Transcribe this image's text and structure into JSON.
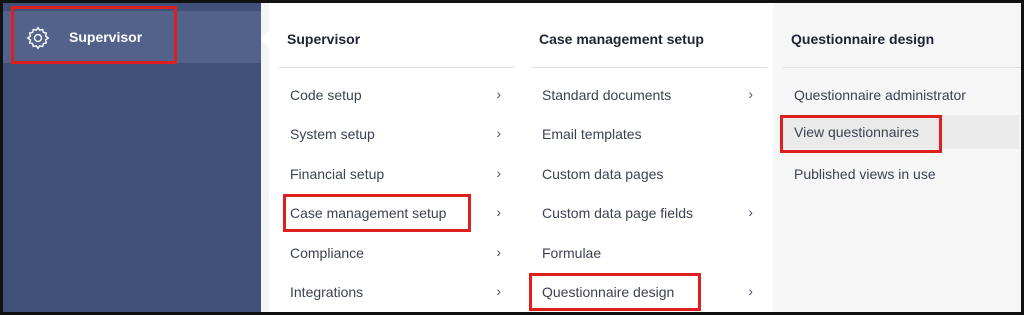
{
  "sidebar": {
    "item_label": "Supervisor",
    "item_icon": "gear-icon"
  },
  "columns": [
    {
      "title": "Supervisor",
      "items": [
        {
          "label": "Code setup",
          "has_submenu": true
        },
        {
          "label": "System setup",
          "has_submenu": true
        },
        {
          "label": "Financial setup",
          "has_submenu": true
        },
        {
          "label": "Case management setup",
          "has_submenu": true
        },
        {
          "label": "Compliance",
          "has_submenu": true
        },
        {
          "label": "Integrations",
          "has_submenu": true
        }
      ]
    },
    {
      "title": "Case management setup",
      "items": [
        {
          "label": "Standard documents",
          "has_submenu": true
        },
        {
          "label": "Email templates",
          "has_submenu": false
        },
        {
          "label": "Custom data pages",
          "has_submenu": false
        },
        {
          "label": "Custom data page fields",
          "has_submenu": true
        },
        {
          "label": "Formulae",
          "has_submenu": false
        },
        {
          "label": "Questionnaire design",
          "has_submenu": true
        }
      ]
    },
    {
      "title": "Questionnaire design",
      "items": [
        {
          "label": "Questionnaire administrator",
          "has_submenu": false
        },
        {
          "label": "View questionnaires",
          "has_submenu": false
        },
        {
          "label": "Published views in use",
          "has_submenu": false
        }
      ]
    }
  ],
  "chevron_glyph": "›",
  "colors": {
    "sidebar_bg": "#3f5079",
    "sidebar_active": "#52628a",
    "highlight": "#dd1f1f"
  }
}
